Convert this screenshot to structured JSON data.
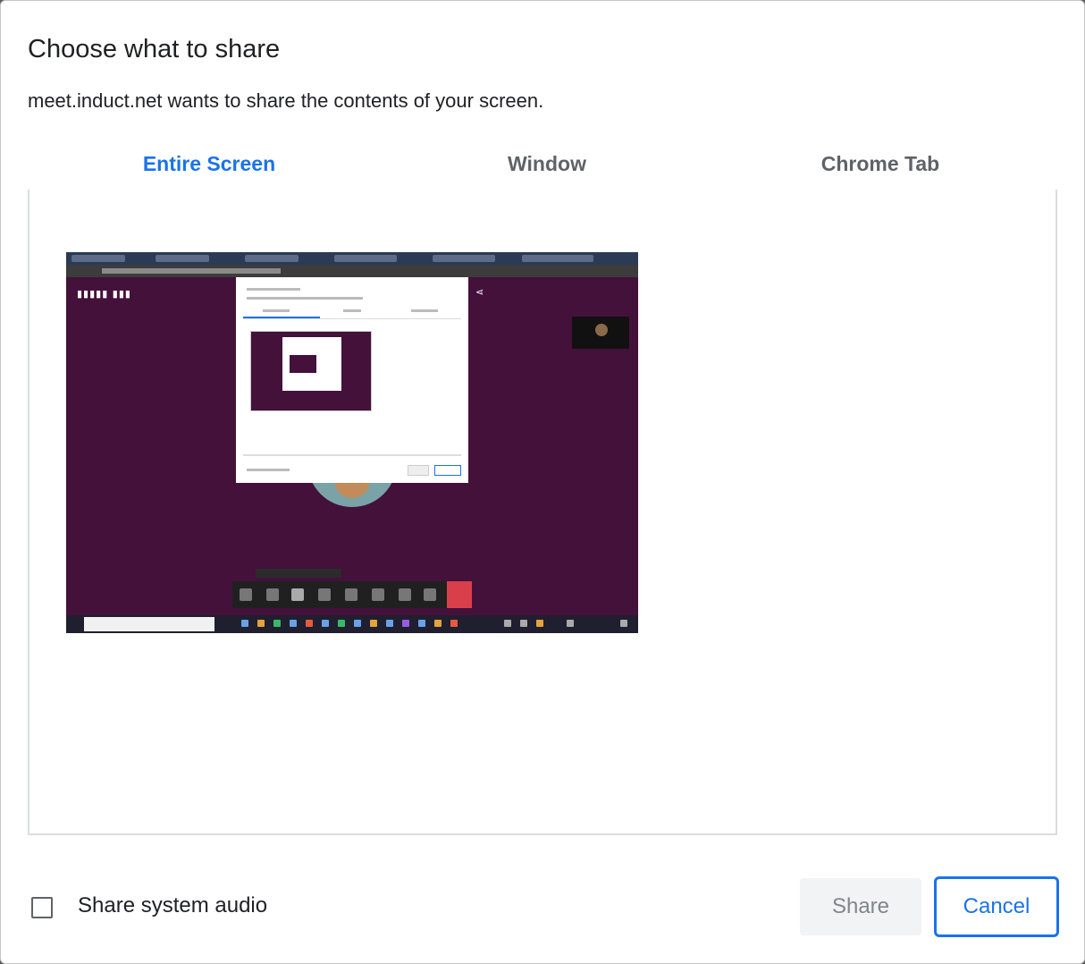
{
  "dialog": {
    "title": "Choose what to share",
    "subtitle": "meet.induct.net wants to share the contents of your screen."
  },
  "tabs": [
    {
      "label": "Entire Screen",
      "active": true
    },
    {
      "label": "Window",
      "active": false
    },
    {
      "label": "Chrome Tab",
      "active": false
    }
  ],
  "preview": {
    "thumbnail_icon": "screen-thumbnail"
  },
  "footer": {
    "share_audio_label": "Share system audio",
    "share_audio_checked": false,
    "share_button": "Share",
    "cancel_button": "Cancel"
  },
  "colors": {
    "accent": "#1a73e8",
    "meeting_background": "#44113b",
    "end_call_red": "#d93f4b"
  }
}
